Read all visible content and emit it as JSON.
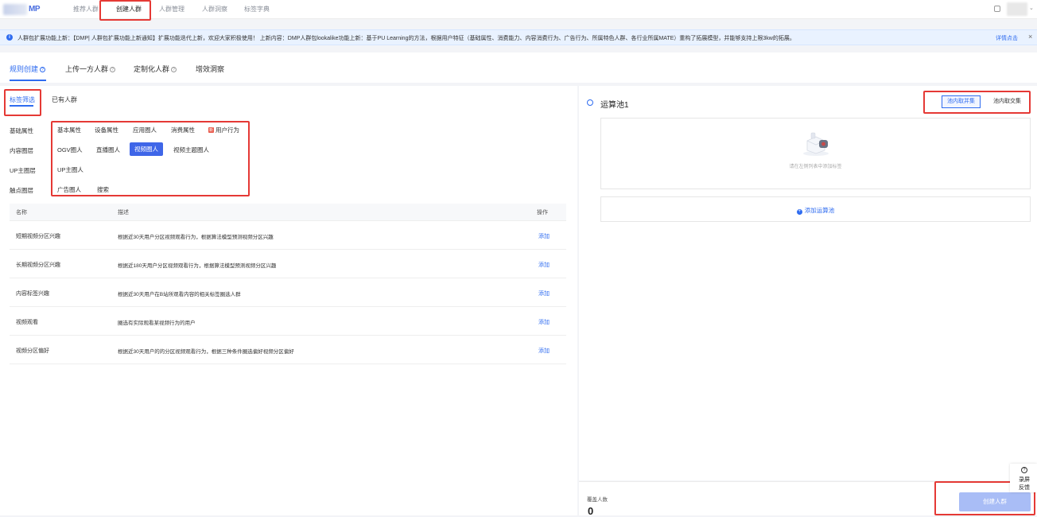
{
  "topbar": {
    "logo_text": "MP",
    "nav": [
      "推荐人群",
      "创建人群",
      "人群管理",
      "人群洞察",
      "标签字典"
    ],
    "active_nav_index": 1
  },
  "notice": {
    "text": "人群包扩展功能上新：【DMP| 人群包扩展功能上新通知】扩展功能迭代上新，欢迎大家积极使用！ 上新内容：DMP人群包lookalike功能上新：基于PU Learning的方法，根据用户特征（基础属性、消费能力、内容消费行为、广告行为、所属特色人群、各行业所属MATE）重构了拓展模型，并能够支持上限3kw的拓展。",
    "link": "详情点击",
    "close": "×"
  },
  "main_tabs": [
    "规则创建",
    "上传一方人群",
    "定制化人群",
    "增效洞察"
  ],
  "sub_tabs": [
    "标签筛选",
    "已有人群"
  ],
  "categories": [
    {
      "label": "基础属性",
      "chips": [
        "基本属性",
        "设备属性",
        "应用圈人",
        "消费属性",
        "用户行为"
      ]
    },
    {
      "label": "内容圈层",
      "chips": [
        "OGV圈人",
        "直播圈人",
        "视频圈人",
        "视频主题圈人"
      ]
    },
    {
      "label": "UP主圈层",
      "chips": [
        "UP主圈人"
      ]
    },
    {
      "label": "触点圈层",
      "chips": [
        "广告圈人",
        "搜索"
      ]
    }
  ],
  "new_badge": "新",
  "table": {
    "headers": [
      "名称",
      "描述",
      "操作"
    ],
    "rows": [
      {
        "name": "短期视频分区兴趣",
        "desc": "根据近30天用户分区视频观看行为，根据算法模型预测视频分区兴趣",
        "op": "添加"
      },
      {
        "name": "长期视频分区兴趣",
        "desc": "根据近180天用户分区视频观看行为，根据算法模型预测视频分区兴趣",
        "op": "添加"
      },
      {
        "name": "内容标签兴趣",
        "desc": "根据近30天用户在B站所观看内容的相关标签圈选人群",
        "op": "添加"
      },
      {
        "name": "视频观看",
        "desc": "圈选有实际观看某视频行为的用户",
        "op": "添加"
      },
      {
        "name": "视频分区偏好",
        "desc": "根据近30天用户的的分区视频观看行为，根据三种条件圈选偏好视频分区偏好",
        "op": "添加"
      }
    ]
  },
  "pool": {
    "title": "运算池1",
    "seg_union": "池内取并集",
    "seg_intersect": "池内取交集",
    "empty_text": "请在左侧列表中添加标签",
    "add_pool": "添加运算池"
  },
  "footer": {
    "coverage_label": "覆盖人数",
    "coverage_value": "0",
    "create_button": "创建人群"
  },
  "float_feedback": {
    "line1": "录屏",
    "line2": "反馈"
  },
  "colors": {
    "accent": "#2f6cf0",
    "highlight": "#e53935"
  }
}
